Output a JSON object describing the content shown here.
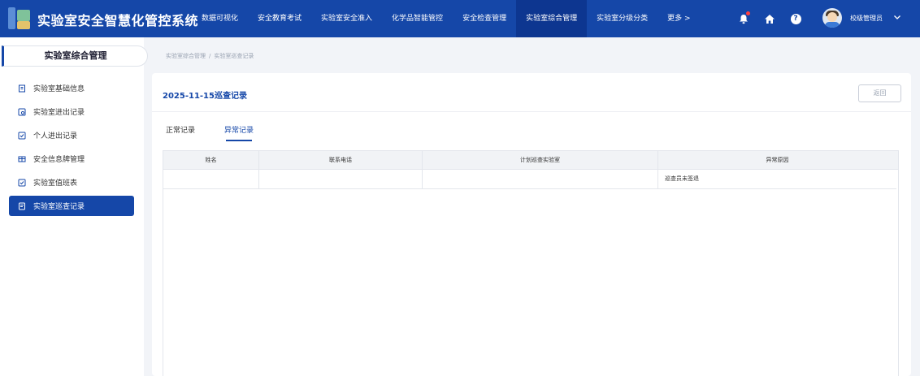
{
  "app": {
    "title": "实验室安全智慧化管控系统"
  },
  "nav": {
    "items": [
      {
        "label": "数据可视化",
        "active": false
      },
      {
        "label": "安全教育考试",
        "active": false
      },
      {
        "label": "实验室安全准入",
        "active": false
      },
      {
        "label": "化学品智能管控",
        "active": false
      },
      {
        "label": "安全检查管理",
        "active": false
      },
      {
        "label": "实验室综合管理",
        "active": true
      },
      {
        "label": "实验室分级分类",
        "active": false
      }
    ],
    "more_label": "更多 >",
    "icons": [
      "bell-icon",
      "home-icon",
      "help-icon"
    ],
    "help_glyph": "?",
    "user": {
      "name": "校级管理员",
      "avatar": "avatar"
    },
    "notification_dot_color": "#ff4040"
  },
  "sidebar": {
    "title": "实验室综合管理",
    "items": [
      {
        "label": "实验室基础信息",
        "icon": "building-icon",
        "active": false
      },
      {
        "label": "实验室进出记录",
        "icon": "door-log-icon",
        "active": false
      },
      {
        "label": "个人进出记录",
        "icon": "person-log-icon",
        "active": false
      },
      {
        "label": "安全信息牌管理",
        "icon": "board-icon",
        "active": false
      },
      {
        "label": "实验室值班表",
        "icon": "duty-icon",
        "active": false
      },
      {
        "label": "实验室巡查记录",
        "icon": "patrol-icon",
        "active": true
      }
    ]
  },
  "breadcrumb": {
    "items": [
      "实验室综合管理",
      "实验室巡查记录"
    ],
    "separator": "/"
  },
  "main": {
    "title": "2025-11-15巡查记录",
    "back_label": "返回",
    "tabs": [
      {
        "label": "正常记录",
        "active": false
      },
      {
        "label": "异常记录",
        "active": true
      }
    ],
    "table": {
      "columns": [
        "姓名",
        "联系电话",
        "计划巡查实验室",
        "异常原因"
      ],
      "rows": [
        [
          "",
          "",
          "",
          "巡查员未签退"
        ]
      ]
    }
  },
  "colors": {
    "brand": "#1547a8",
    "nav_active": "#0d3690",
    "accent": "#1547a8"
  }
}
